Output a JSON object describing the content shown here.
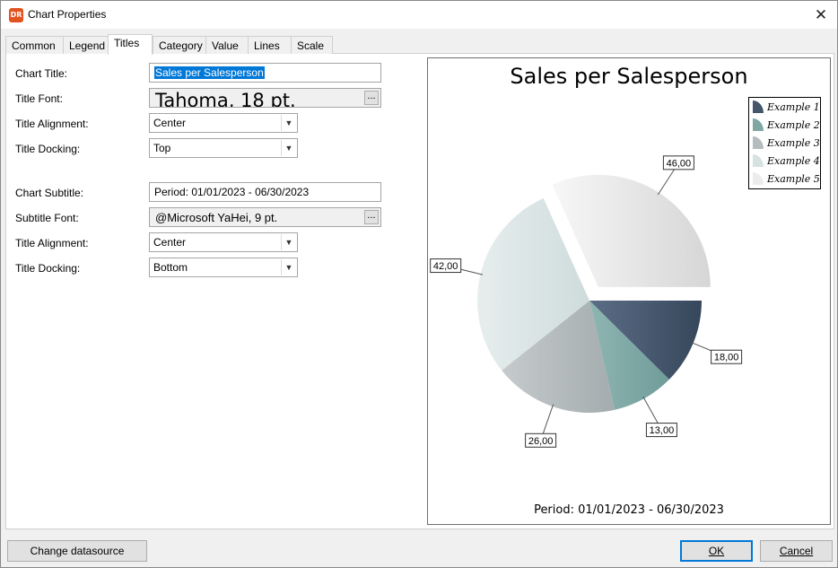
{
  "window": {
    "title": "Chart Properties",
    "app_icon_text": "DR",
    "close_glyph": "✕"
  },
  "tabs": [
    {
      "label": "Common"
    },
    {
      "label": "Legend"
    },
    {
      "label": "Titles",
      "active": true
    },
    {
      "label": "Category"
    },
    {
      "label": "Value"
    },
    {
      "label": "Lines"
    },
    {
      "label": "Scale"
    }
  ],
  "form": {
    "chart_title_label": "Chart Title:",
    "chart_title_value": "Sales per Salesperson",
    "title_font_label": "Title Font:",
    "title_font_value": "Tahoma, 18 pt.",
    "title_alignment_label": "Title Alignment:",
    "title_alignment_value": "Center",
    "title_docking_label": "Title Docking:",
    "title_docking_value": "Top",
    "chart_subtitle_label": "Chart Subtitle:",
    "chart_subtitle_value": "Period: 01/01/2023 - 06/30/2023",
    "subtitle_font_label": "Subtitle Font:",
    "subtitle_font_value": "@Microsoft YaHei, 9 pt.",
    "subtitle_alignment_label": "Title Alignment:",
    "subtitle_alignment_value": "Center",
    "subtitle_docking_label": "Title Docking:",
    "subtitle_docking_value": "Bottom",
    "ellipsis": "...",
    "combo_arrow": "▼"
  },
  "chart_data": {
    "type": "pie",
    "title": "Sales per Salesperson",
    "subtitle": "Period: 01/01/2023 - 06/30/2023",
    "legend_position": "top-right",
    "slices": [
      {
        "name": "Example 1",
        "value": 18,
        "label": "18,00",
        "color_light": "#5c6e87",
        "color_dark": "#36475b"
      },
      {
        "name": "Example 2",
        "value": 13,
        "label": "13,00",
        "color_light": "#8fb5b2",
        "color_dark": "#6f9c99"
      },
      {
        "name": "Example 3",
        "value": 26,
        "label": "26,00",
        "color_light": "#c6cbcc",
        "color_dark": "#a3acae"
      },
      {
        "name": "Example 4",
        "value": 42,
        "label": "42,00",
        "color_light": "#e6eded",
        "color_dark": "#cfdcdc"
      },
      {
        "name": "Example 5",
        "value": 46,
        "label": "46,00",
        "color_light": "#f7f7f7",
        "color_dark": "#d6d6d6",
        "exploded": true
      }
    ]
  },
  "footer": {
    "change_datasource": "Change datasource",
    "ok": "OK",
    "cancel": "Cancel"
  },
  "colors": {
    "selection": "#0078d7",
    "app_icon": "#e2531f"
  }
}
